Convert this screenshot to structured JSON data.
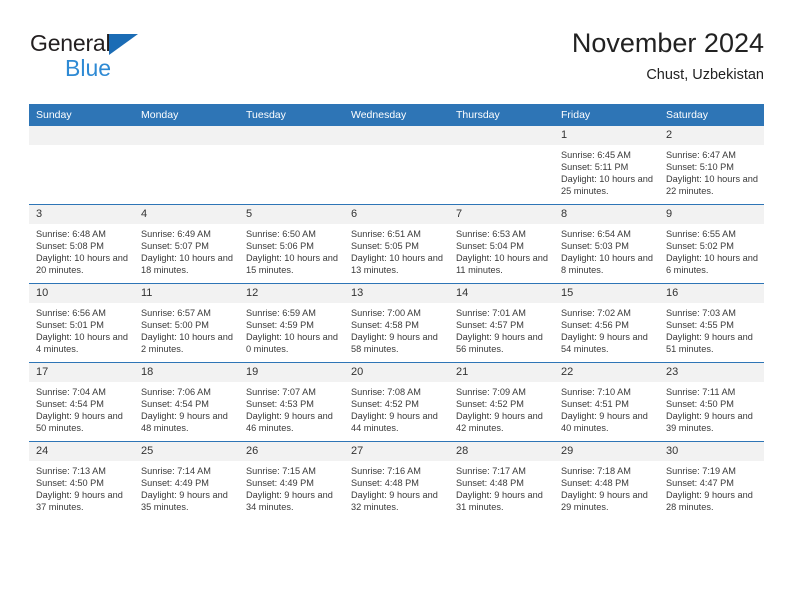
{
  "brand": {
    "name_part1": "General",
    "name_part2": "Blue",
    "logo_icon": "triangle-flag-icon"
  },
  "header": {
    "title": "November 2024",
    "location": "Chust, Uzbekistan"
  },
  "calendar": {
    "weekday_headers": [
      "Sunday",
      "Monday",
      "Tuesday",
      "Wednesday",
      "Thursday",
      "Friday",
      "Saturday"
    ],
    "accent_color": "#2e75b6",
    "daynum_background": "#f2f2f2",
    "weeks": [
      [
        {
          "day": "",
          "blank": true
        },
        {
          "day": "",
          "blank": true
        },
        {
          "day": "",
          "blank": true
        },
        {
          "day": "",
          "blank": true
        },
        {
          "day": "",
          "blank": true
        },
        {
          "day": "1",
          "sunrise": "Sunrise: 6:45 AM",
          "sunset": "Sunset: 5:11 PM",
          "daylight": "Daylight: 10 hours and 25 minutes."
        },
        {
          "day": "2",
          "sunrise": "Sunrise: 6:47 AM",
          "sunset": "Sunset: 5:10 PM",
          "daylight": "Daylight: 10 hours and 22 minutes."
        }
      ],
      [
        {
          "day": "3",
          "sunrise": "Sunrise: 6:48 AM",
          "sunset": "Sunset: 5:08 PM",
          "daylight": "Daylight: 10 hours and 20 minutes."
        },
        {
          "day": "4",
          "sunrise": "Sunrise: 6:49 AM",
          "sunset": "Sunset: 5:07 PM",
          "daylight": "Daylight: 10 hours and 18 minutes."
        },
        {
          "day": "5",
          "sunrise": "Sunrise: 6:50 AM",
          "sunset": "Sunset: 5:06 PM",
          "daylight": "Daylight: 10 hours and 15 minutes."
        },
        {
          "day": "6",
          "sunrise": "Sunrise: 6:51 AM",
          "sunset": "Sunset: 5:05 PM",
          "daylight": "Daylight: 10 hours and 13 minutes."
        },
        {
          "day": "7",
          "sunrise": "Sunrise: 6:53 AM",
          "sunset": "Sunset: 5:04 PM",
          "daylight": "Daylight: 10 hours and 11 minutes."
        },
        {
          "day": "8",
          "sunrise": "Sunrise: 6:54 AM",
          "sunset": "Sunset: 5:03 PM",
          "daylight": "Daylight: 10 hours and 8 minutes."
        },
        {
          "day": "9",
          "sunrise": "Sunrise: 6:55 AM",
          "sunset": "Sunset: 5:02 PM",
          "daylight": "Daylight: 10 hours and 6 minutes."
        }
      ],
      [
        {
          "day": "10",
          "sunrise": "Sunrise: 6:56 AM",
          "sunset": "Sunset: 5:01 PM",
          "daylight": "Daylight: 10 hours and 4 minutes."
        },
        {
          "day": "11",
          "sunrise": "Sunrise: 6:57 AM",
          "sunset": "Sunset: 5:00 PM",
          "daylight": "Daylight: 10 hours and 2 minutes."
        },
        {
          "day": "12",
          "sunrise": "Sunrise: 6:59 AM",
          "sunset": "Sunset: 4:59 PM",
          "daylight": "Daylight: 10 hours and 0 minutes."
        },
        {
          "day": "13",
          "sunrise": "Sunrise: 7:00 AM",
          "sunset": "Sunset: 4:58 PM",
          "daylight": "Daylight: 9 hours and 58 minutes."
        },
        {
          "day": "14",
          "sunrise": "Sunrise: 7:01 AM",
          "sunset": "Sunset: 4:57 PM",
          "daylight": "Daylight: 9 hours and 56 minutes."
        },
        {
          "day": "15",
          "sunrise": "Sunrise: 7:02 AM",
          "sunset": "Sunset: 4:56 PM",
          "daylight": "Daylight: 9 hours and 54 minutes."
        },
        {
          "day": "16",
          "sunrise": "Sunrise: 7:03 AM",
          "sunset": "Sunset: 4:55 PM",
          "daylight": "Daylight: 9 hours and 51 minutes."
        }
      ],
      [
        {
          "day": "17",
          "sunrise": "Sunrise: 7:04 AM",
          "sunset": "Sunset: 4:54 PM",
          "daylight": "Daylight: 9 hours and 50 minutes."
        },
        {
          "day": "18",
          "sunrise": "Sunrise: 7:06 AM",
          "sunset": "Sunset: 4:54 PM",
          "daylight": "Daylight: 9 hours and 48 minutes."
        },
        {
          "day": "19",
          "sunrise": "Sunrise: 7:07 AM",
          "sunset": "Sunset: 4:53 PM",
          "daylight": "Daylight: 9 hours and 46 minutes."
        },
        {
          "day": "20",
          "sunrise": "Sunrise: 7:08 AM",
          "sunset": "Sunset: 4:52 PM",
          "daylight": "Daylight: 9 hours and 44 minutes."
        },
        {
          "day": "21",
          "sunrise": "Sunrise: 7:09 AM",
          "sunset": "Sunset: 4:52 PM",
          "daylight": "Daylight: 9 hours and 42 minutes."
        },
        {
          "day": "22",
          "sunrise": "Sunrise: 7:10 AM",
          "sunset": "Sunset: 4:51 PM",
          "daylight": "Daylight: 9 hours and 40 minutes."
        },
        {
          "day": "23",
          "sunrise": "Sunrise: 7:11 AM",
          "sunset": "Sunset: 4:50 PM",
          "daylight": "Daylight: 9 hours and 39 minutes."
        }
      ],
      [
        {
          "day": "24",
          "sunrise": "Sunrise: 7:13 AM",
          "sunset": "Sunset: 4:50 PM",
          "daylight": "Daylight: 9 hours and 37 minutes."
        },
        {
          "day": "25",
          "sunrise": "Sunrise: 7:14 AM",
          "sunset": "Sunset: 4:49 PM",
          "daylight": "Daylight: 9 hours and 35 minutes."
        },
        {
          "day": "26",
          "sunrise": "Sunrise: 7:15 AM",
          "sunset": "Sunset: 4:49 PM",
          "daylight": "Daylight: 9 hours and 34 minutes."
        },
        {
          "day": "27",
          "sunrise": "Sunrise: 7:16 AM",
          "sunset": "Sunset: 4:48 PM",
          "daylight": "Daylight: 9 hours and 32 minutes."
        },
        {
          "day": "28",
          "sunrise": "Sunrise: 7:17 AM",
          "sunset": "Sunset: 4:48 PM",
          "daylight": "Daylight: 9 hours and 31 minutes."
        },
        {
          "day": "29",
          "sunrise": "Sunrise: 7:18 AM",
          "sunset": "Sunset: 4:48 PM",
          "daylight": "Daylight: 9 hours and 29 minutes."
        },
        {
          "day": "30",
          "sunrise": "Sunrise: 7:19 AM",
          "sunset": "Sunset: 4:47 PM",
          "daylight": "Daylight: 9 hours and 28 minutes."
        }
      ]
    ]
  }
}
